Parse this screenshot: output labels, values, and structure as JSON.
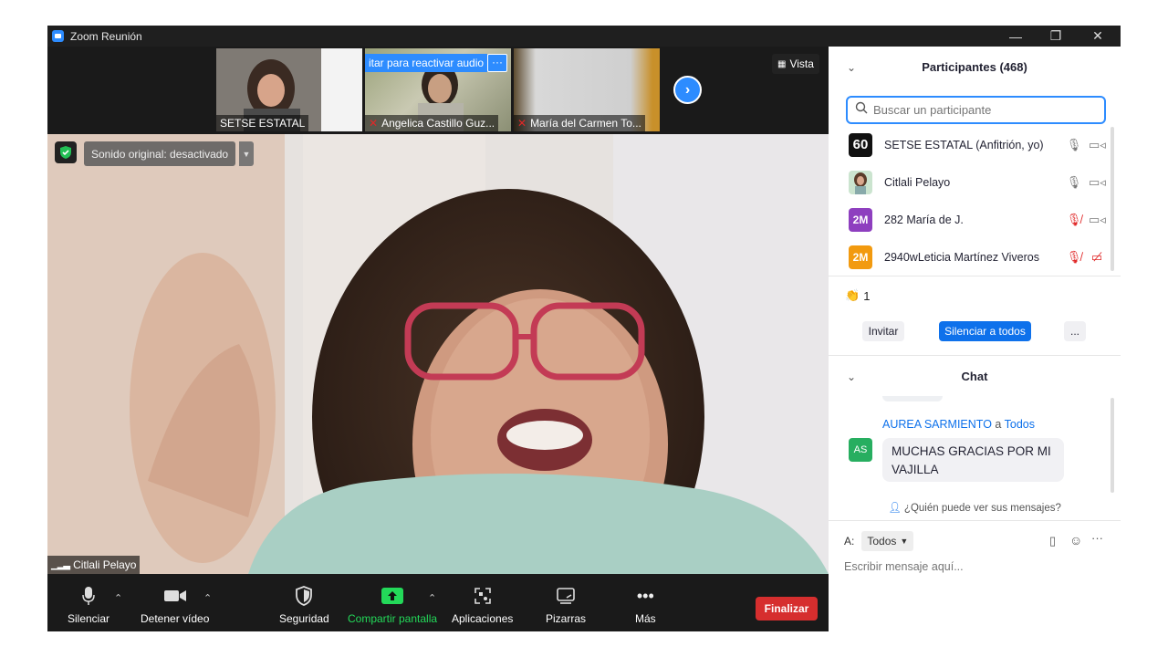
{
  "window": {
    "title": "Zoom Reunión",
    "minimize": "—",
    "restore": "❐",
    "close": "✕"
  },
  "strip": {
    "thumbs": [
      {
        "name": "SETSE ESTATAL",
        "muted": false
      },
      {
        "name": "Angelica Castillo Guz...",
        "muted": true,
        "banner": "itar para reactivar audio"
      },
      {
        "name": "María del Carmen To...",
        "muted": true
      }
    ],
    "vista_label": "Vista"
  },
  "video": {
    "sonido": "Sonido original: desactivado",
    "speaker": "Citlali Pelayo"
  },
  "toolbar": {
    "silenciar": "Silenciar",
    "detener_video": "Detener vídeo",
    "seguridad": "Seguridad",
    "compartir": "Compartir pantalla",
    "aplicaciones": "Aplicaciones",
    "pizarras": "Pizarras",
    "mas": "Más",
    "finalizar": "Finalizar"
  },
  "participants": {
    "title": "Participantes (468)",
    "search_placeholder": "Buscar un participante",
    "items": [
      {
        "avatar": "60",
        "name": "SETSE ESTATAL (Anfitrión, yo)",
        "mic_muted": false,
        "video_off": false
      },
      {
        "avatar": "",
        "name": "Citlali Pelayo",
        "mic_muted": false,
        "video_off": false
      },
      {
        "avatar": "2M",
        "name": "282 María de J.",
        "mic_muted": true,
        "video_off": false
      },
      {
        "avatar": "2M",
        "name": "2940wLeticia Martínez Viveros",
        "mic_muted": true,
        "video_off": true
      }
    ],
    "reaction_count": "1",
    "invitar": "Invitar",
    "silenciar_todos": "Silenciar a todos",
    "more": "..."
  },
  "chat": {
    "title": "Chat",
    "sender": "AUREA SARMIENTO",
    "a_label": "a",
    "recipient": "Todos",
    "avatar": "AS",
    "message": "MUCHAS GRACIAS POR MI VAJILLA",
    "who_can_see": "¿Quién puede ver sus mensajes?",
    "to_label": "A:",
    "to_value": "Todos",
    "input_placeholder": "Escribir mensaje aquí..."
  },
  "colors": {
    "accent": "#2d8cff",
    "danger": "#d62e2e",
    "share_green": "#23d959"
  }
}
